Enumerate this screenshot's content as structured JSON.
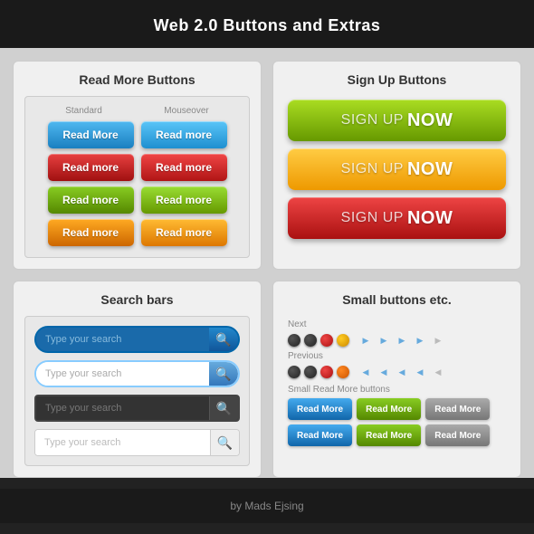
{
  "header": {
    "title": "Web 2.0 Buttons and Extras"
  },
  "read_more": {
    "title": "Read More Buttons",
    "col_standard": "Standard",
    "col_mouseover": "Mouseover",
    "rows": [
      {
        "std": "Read More",
        "hover": "Read more"
      },
      {
        "std": "Read more",
        "hover": "Read more"
      },
      {
        "std": "Read more",
        "hover": "Read more"
      },
      {
        "std": "Read more",
        "hover": "Read more"
      }
    ]
  },
  "signup": {
    "title": "Sign Up Buttons",
    "buttons": [
      {
        "label_sign": "SIGN UP",
        "label_now": "NOW"
      },
      {
        "label_sign": "SIGN UP",
        "label_now": "NOW"
      },
      {
        "label_sign": "SIGN UP",
        "label_now": "NOW"
      }
    ]
  },
  "search": {
    "title": "Search bars",
    "placeholders": [
      "Type your search",
      "Type your search",
      "Type your search",
      "Type your search"
    ]
  },
  "small": {
    "title": "Small buttons etc.",
    "next_label": "Next",
    "previous_label": "Previous",
    "small_label": "Small Read More buttons",
    "read_more_labels": [
      "Read More",
      "Read More",
      "Read More",
      "Read More",
      "Read More",
      "Read More"
    ]
  },
  "footer": {
    "text": "by Mads Ejsing"
  }
}
